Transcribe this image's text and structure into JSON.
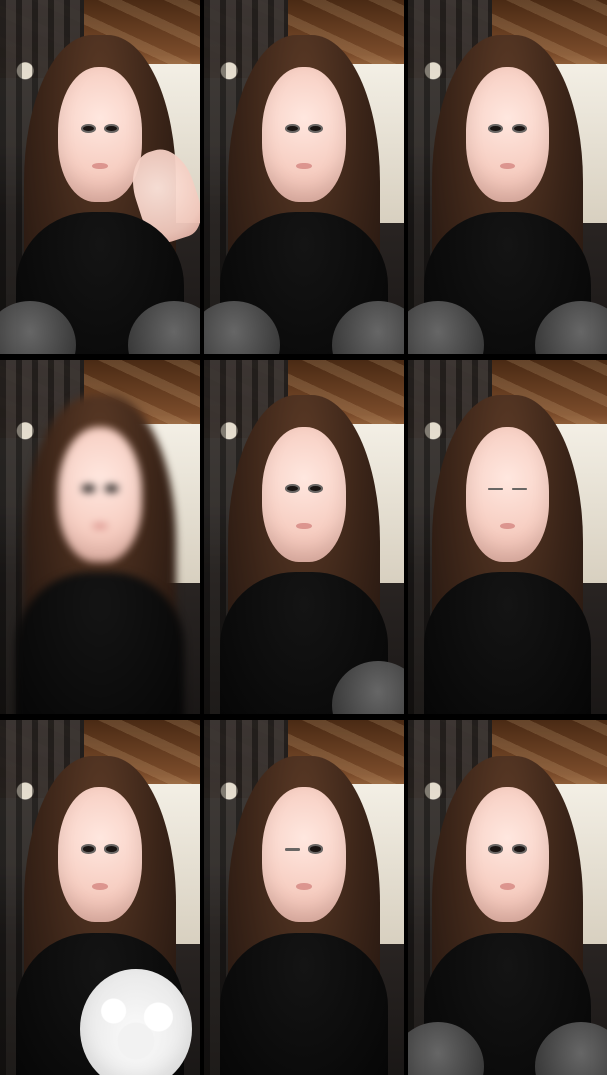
{
  "grid": {
    "rows": 3,
    "cols": 3,
    "tiles": [
      {
        "variant": "hand-on-face"
      },
      {
        "variant": "straight"
      },
      {
        "variant": "straight"
      },
      {
        "variant": "motion-blur"
      },
      {
        "variant": "straight"
      },
      {
        "variant": "eyes-closed"
      },
      {
        "variant": "puppy"
      },
      {
        "variant": "wink"
      },
      {
        "variant": "straight"
      }
    ]
  }
}
